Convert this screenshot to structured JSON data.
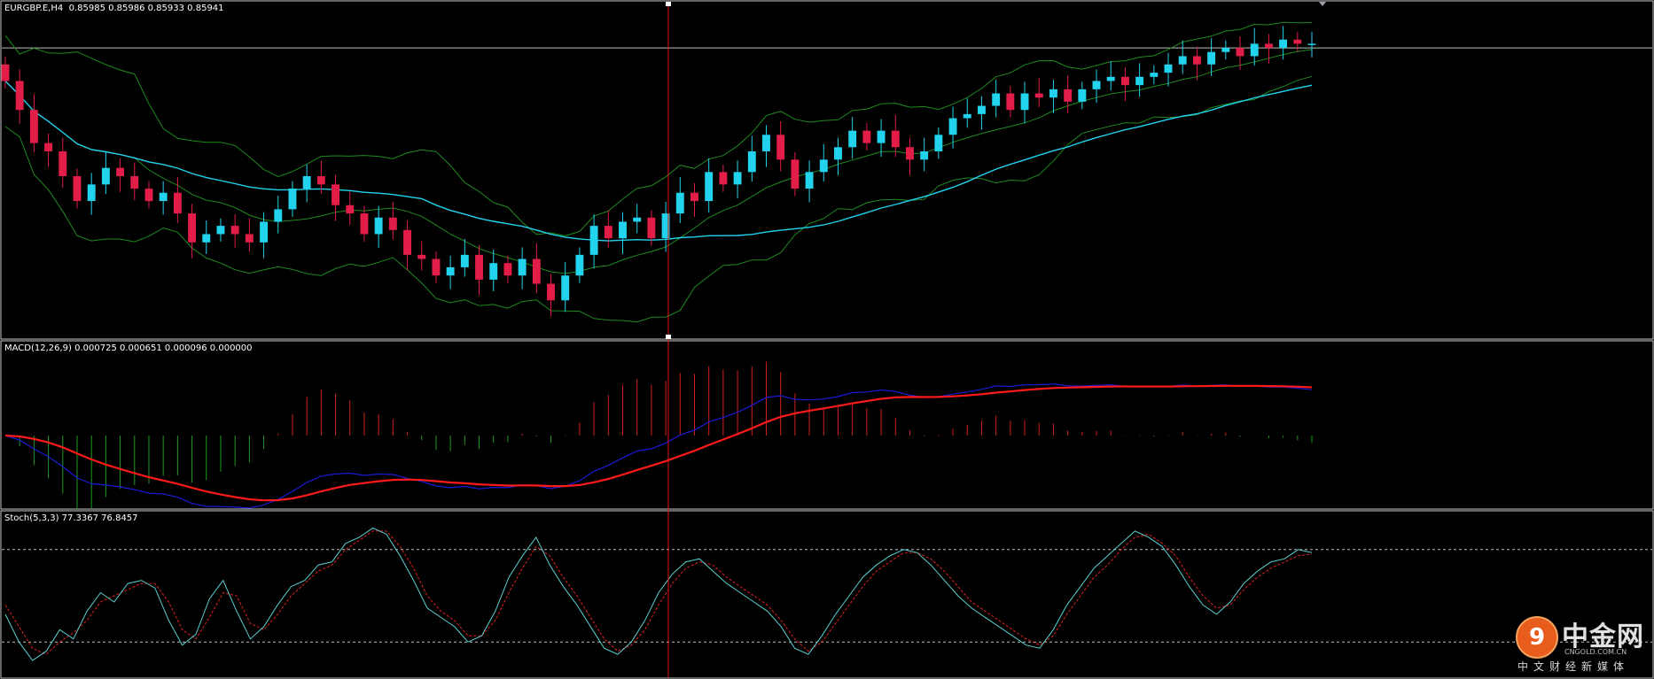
{
  "panels": {
    "price_label": "EURGBP.E,H4  0.85985 0.85986 0.85933 0.85941",
    "macd_label": "MACD(12,26,9) 0.000725 0.000651 0.000096 0.000000",
    "stoch_label": "Stoch(5,3,3) 77.3367 76.8457"
  },
  "watermark": {
    "name": "中金网",
    "url": "CNGOLD.COM.CN",
    "tagline": "中文财经新媒体"
  },
  "colors": {
    "background": "#000000",
    "bull_candle": "#22d3ee",
    "bear_candle": "#e11d48",
    "bollinger": "#1f8a1f",
    "moving_average": "#22d3ee",
    "macd_main": "#1b1bd6",
    "macd_signal": "#ff1a1a",
    "hist_positive": "#d21f1f",
    "hist_negative": "#1e9a1e",
    "stoch_main": "#5ccfcf",
    "stoch_signal": "#e02020",
    "cursor": "#e01010"
  },
  "chart_data": [
    {
      "type": "candlestick",
      "symbol": "EURGBP.E",
      "timeframe": "H4",
      "last_ohlc": [
        0.85985,
        0.85986,
        0.85933,
        0.85941
      ],
      "overlays": [
        "bollinger-bands",
        "moving-average"
      ],
      "close_series": [
        0.8605,
        0.8598,
        0.859,
        0.8588,
        0.8582,
        0.8576,
        0.858,
        0.8584,
        0.8582,
        0.8579,
        0.8576,
        0.8578,
        0.8573,
        0.8566,
        0.8568,
        0.857,
        0.8568,
        0.8566,
        0.8571,
        0.8574,
        0.8579,
        0.8582,
        0.858,
        0.8575,
        0.8573,
        0.8568,
        0.8572,
        0.8569,
        0.8563,
        0.8562,
        0.8558,
        0.856,
        0.8563,
        0.8557,
        0.8561,
        0.8558,
        0.8562,
        0.8556,
        0.8552,
        0.8558,
        0.8563,
        0.857,
        0.8567,
        0.8571,
        0.8572,
        0.8567,
        0.8573,
        0.8578,
        0.8576,
        0.8583,
        0.858,
        0.8583,
        0.8588,
        0.8592,
        0.8586,
        0.8579,
        0.8583,
        0.8586,
        0.8589,
        0.8593,
        0.859,
        0.8593,
        0.8589,
        0.8586,
        0.8588,
        0.8592,
        0.8596,
        0.8597,
        0.8599,
        0.8602,
        0.8598,
        0.8602,
        0.8601,
        0.8603,
        0.86,
        0.8603,
        0.8605,
        0.8606,
        0.8604,
        0.8606,
        0.8607,
        0.8609,
        0.8611,
        0.8609,
        0.8612,
        0.8613,
        0.8611,
        0.8614,
        0.8613,
        0.8615,
        0.8614,
        0.8614
      ],
      "horizontal_line": 0.8613
    },
    {
      "type": "line",
      "indicator": "MACD(12,26,9)",
      "values": [
        0.000725,
        0.000651,
        9.6e-05,
        0.0
      ],
      "series": [
        "main",
        "signal",
        "histogram"
      ]
    },
    {
      "type": "line",
      "indicator": "Stoch(5,3,3)",
      "values": [
        77.3367,
        76.8457
      ],
      "levels": [
        80,
        20
      ],
      "ylim": [
        0,
        100
      ],
      "k_series": [
        38,
        20,
        8,
        14,
        28,
        22,
        40,
        52,
        46,
        58,
        60,
        55,
        34,
        18,
        25,
        48,
        60,
        40,
        22,
        30,
        44,
        56,
        60,
        70,
        72,
        84,
        88,
        94,
        90,
        76,
        60,
        42,
        36,
        30,
        20,
        24,
        40,
        62,
        76,
        88,
        70,
        56,
        44,
        30,
        16,
        12,
        20,
        34,
        52,
        64,
        72,
        74,
        66,
        58,
        52,
        46,
        40,
        30,
        16,
        12,
        24,
        38,
        50,
        62,
        70,
        76,
        80,
        78,
        70,
        60,
        50,
        42,
        36,
        30,
        24,
        18,
        16,
        28,
        44,
        56,
        68,
        76,
        84,
        92,
        88,
        82,
        70,
        56,
        44,
        38,
        46,
        58,
        66,
        72,
        74,
        80,
        78
      ],
      "d_series": [
        44,
        30,
        16,
        12,
        20,
        26,
        34,
        46,
        50,
        54,
        58,
        58,
        46,
        28,
        22,
        36,
        52,
        50,
        32,
        28,
        38,
        50,
        58,
        66,
        70,
        80,
        86,
        92,
        92,
        82,
        68,
        50,
        40,
        34,
        24,
        24,
        34,
        52,
        68,
        82,
        76,
        62,
        50,
        36,
        22,
        14,
        18,
        28,
        44,
        58,
        68,
        72,
        70,
        62,
        56,
        50,
        44,
        34,
        22,
        14,
        20,
        32,
        44,
        56,
        66,
        72,
        78,
        78,
        74,
        66,
        56,
        46,
        40,
        34,
        28,
        22,
        18,
        24,
        38,
        50,
        62,
        70,
        80,
        88,
        90,
        84,
        76,
        62,
        50,
        42,
        44,
        54,
        62,
        68,
        72,
        76,
        77
      ]
    }
  ]
}
